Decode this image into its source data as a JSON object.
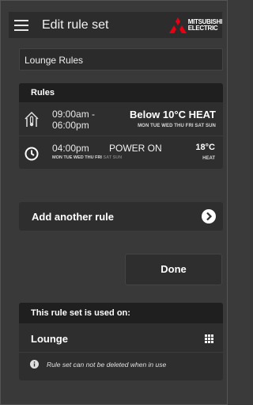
{
  "header": {
    "title": "Edit rule set",
    "logo_line1": "MITSUBISHI",
    "logo_line2": "ELECTRIC",
    "logo_color": "#e60012"
  },
  "name_field": {
    "value": "Lounge Rules"
  },
  "rules": {
    "heading": "Rules",
    "items": [
      {
        "icon": "house-icon",
        "time_start": "09:00am -",
        "time_end": "06:00pm",
        "action": "Below 10°C HEAT",
        "days": "MON TUE WED THU FRI SAT SUN"
      },
      {
        "icon": "clock-icon",
        "time": "04:00pm",
        "days_active": "MON TUE WED THU FRI",
        "days_inactive": "SAT SUN",
        "action": "POWER ON",
        "temp": "18°C",
        "mode": "HEAT"
      }
    ]
  },
  "add_rule": {
    "label": "Add another rule"
  },
  "done": {
    "label": "Done"
  },
  "used_on": {
    "heading": "This rule set is used on:",
    "unit": "Lounge",
    "note": "Rule set can not be deleted when in use"
  }
}
